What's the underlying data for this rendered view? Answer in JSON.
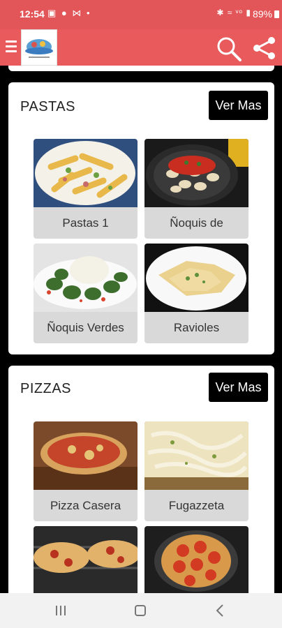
{
  "status_bar": {
    "time": "12:54",
    "left_icons": "▣ ● ⋈ •",
    "right_icons": "✱ ≈ ᵛᵒ ▮",
    "battery": "89%"
  },
  "app_bar": {
    "menu_icon": "hamburger-menu-icon",
    "logo": "app-logo",
    "search_icon": "search-icon",
    "share_icon": "share-icon",
    "accent_color": "#e85a5c"
  },
  "sections": [
    {
      "title": "PASTAS",
      "button": "Ver Mas",
      "items": [
        {
          "label": "Pastas 1"
        },
        {
          "label": "Ñoquis de"
        },
        {
          "label": "Ñoquis Verdes"
        },
        {
          "label": "Ravioles"
        }
      ]
    },
    {
      "title": "PIZZAS",
      "button": "Ver Mas",
      "items": [
        {
          "label": "Pizza Casera"
        },
        {
          "label": "Fugazzeta"
        },
        {
          "label": ""
        },
        {
          "label": ""
        }
      ]
    }
  ],
  "nav_bar": {
    "recents_icon": "recents-icon",
    "home_icon": "home-icon",
    "back_icon": "back-icon"
  }
}
